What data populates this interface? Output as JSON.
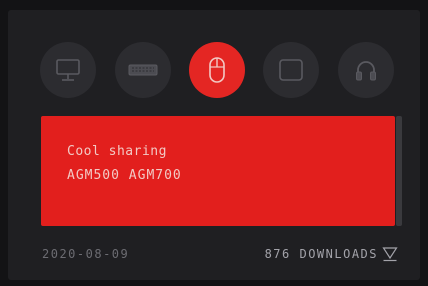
{
  "devices": [
    {
      "name": "monitor",
      "icon": "monitor-icon",
      "active": false
    },
    {
      "name": "keyboard",
      "icon": "keyboard-icon",
      "active": false
    },
    {
      "name": "mouse",
      "icon": "mouse-icon",
      "active": true
    },
    {
      "name": "mousepad",
      "icon": "mousepad-icon",
      "active": false
    },
    {
      "name": "headset",
      "icon": "headset-icon",
      "active": false
    }
  ],
  "card": {
    "title": "Cool sharing",
    "models": "AGM500 AGM700"
  },
  "footer": {
    "date": "2020-08-09",
    "downloads": "876 DOWNLOADS"
  },
  "colors": {
    "accent": "#e21f1d",
    "panel": "#1f1f22",
    "device_bg": "#2c2c30"
  }
}
